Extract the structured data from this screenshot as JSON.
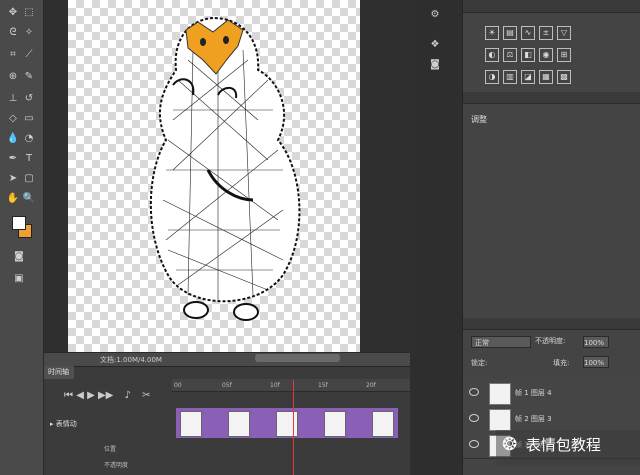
{
  "timeline": {
    "tab_label": "时间轴",
    "layer_group_label": "表情动",
    "ruler_ticks": [
      "00",
      "05f",
      "10f",
      "15f",
      "20f"
    ],
    "track_labels": [
      "位置",
      "不透明度"
    ]
  },
  "statusbar": {
    "text": "文档:1.00M/4.00M"
  },
  "layers_panel": {
    "blend_mode": "正常",
    "opacity_label": "不透明度:",
    "opacity_value": "100%",
    "fill_label": "填充:",
    "fill_value": "100%",
    "lock_label": "锁定:",
    "rows": [
      {
        "name": "帧 1 图层 4"
      },
      {
        "name": "帧 2 图层 3"
      },
      {
        "name": "帧 3 图层 2"
      }
    ]
  },
  "properties_panel": {
    "label": "调整"
  },
  "watermark": {
    "text": "表情包教程"
  },
  "colors": {
    "background_swatch": "#f0a030",
    "frame_strip": "#8a5fb8",
    "accent_orange": "#f0a020"
  }
}
